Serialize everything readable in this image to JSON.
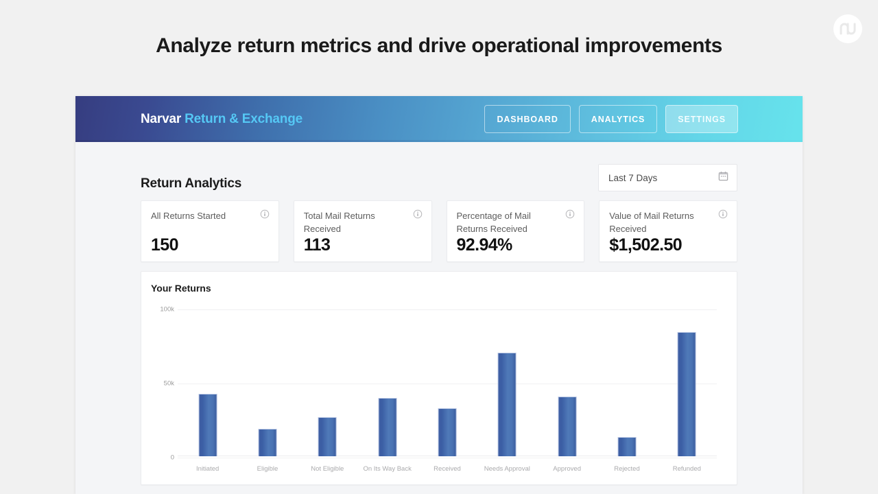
{
  "page": {
    "heading": "Analyze return metrics and drive operational improvements",
    "background_color": "#f1f1f1"
  },
  "brand_badge": {
    "icon": "narvar-logo-icon",
    "background_color": "#ffffff",
    "glyph_color": "#e8e8e8"
  },
  "app": {
    "header": {
      "logo_primary": "Narvar",
      "logo_secondary": "Return & Exchange",
      "gradient_from": "#363d80",
      "gradient_to": "#66e3ec",
      "logo_secondary_color": "#55c8f5",
      "nav": [
        {
          "label": "DASHBOARD",
          "active": false
        },
        {
          "label": "ANALYTICS",
          "active": false
        },
        {
          "label": "SETTINGS",
          "active": true
        }
      ]
    },
    "section_title": "Return Analytics",
    "date_range": {
      "value": "Last 7 Days",
      "icon": "calendar-icon"
    },
    "metrics": [
      {
        "label": "All Returns Started",
        "value": "150",
        "info_icon": "info-icon"
      },
      {
        "label": "Total Mail Returns Received",
        "value": "113",
        "info_icon": "info-icon"
      },
      {
        "label": "Percentage of Mail Returns Received",
        "value": "92.94%",
        "info_icon": "info-icon"
      },
      {
        "label": "Value of Mail Returns Received",
        "value": "$1,502.50",
        "info_icon": "info-icon"
      }
    ],
    "chart_title": "Your Returns"
  },
  "chart_data": {
    "type": "bar",
    "title": "Your Returns",
    "xlabel": "",
    "ylabel": "",
    "ylim": [
      0,
      100000
    ],
    "grid": true,
    "legend": false,
    "tick_labels": [
      "0",
      "50k",
      "100k"
    ],
    "tick_values": [
      0,
      50000,
      100000
    ],
    "categories": [
      "Initiated",
      "Eligible",
      "Not Eligible",
      "On Its Way Back",
      "Received",
      "Needs Approval",
      "Approved",
      "Rejected",
      "Refunded"
    ],
    "values": [
      42000,
      18500,
      26500,
      39500,
      32500,
      70000,
      40500,
      13000,
      84000
    ],
    "bar_color": "#43679f"
  }
}
